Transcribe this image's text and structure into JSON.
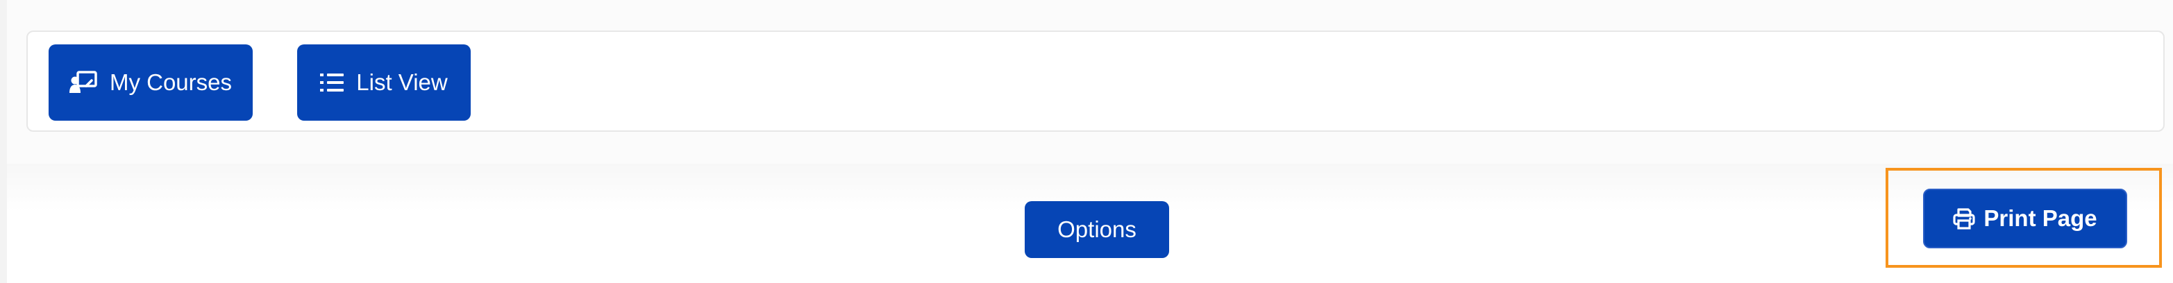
{
  "toolbar": {
    "my_courses_label": "My Courses",
    "my_courses_icon": "chalkboard-teacher-icon",
    "list_view_label": "List View",
    "list_view_icon": "list-icon"
  },
  "actions": {
    "options_label": "Options",
    "print_label": "Print Page",
    "print_icon": "printer-icon"
  },
  "colors": {
    "button_bg": "#0645b5",
    "button_text": "#ffffff",
    "highlight_border": "#f7941d",
    "panel_border": "#e7e7e7"
  }
}
